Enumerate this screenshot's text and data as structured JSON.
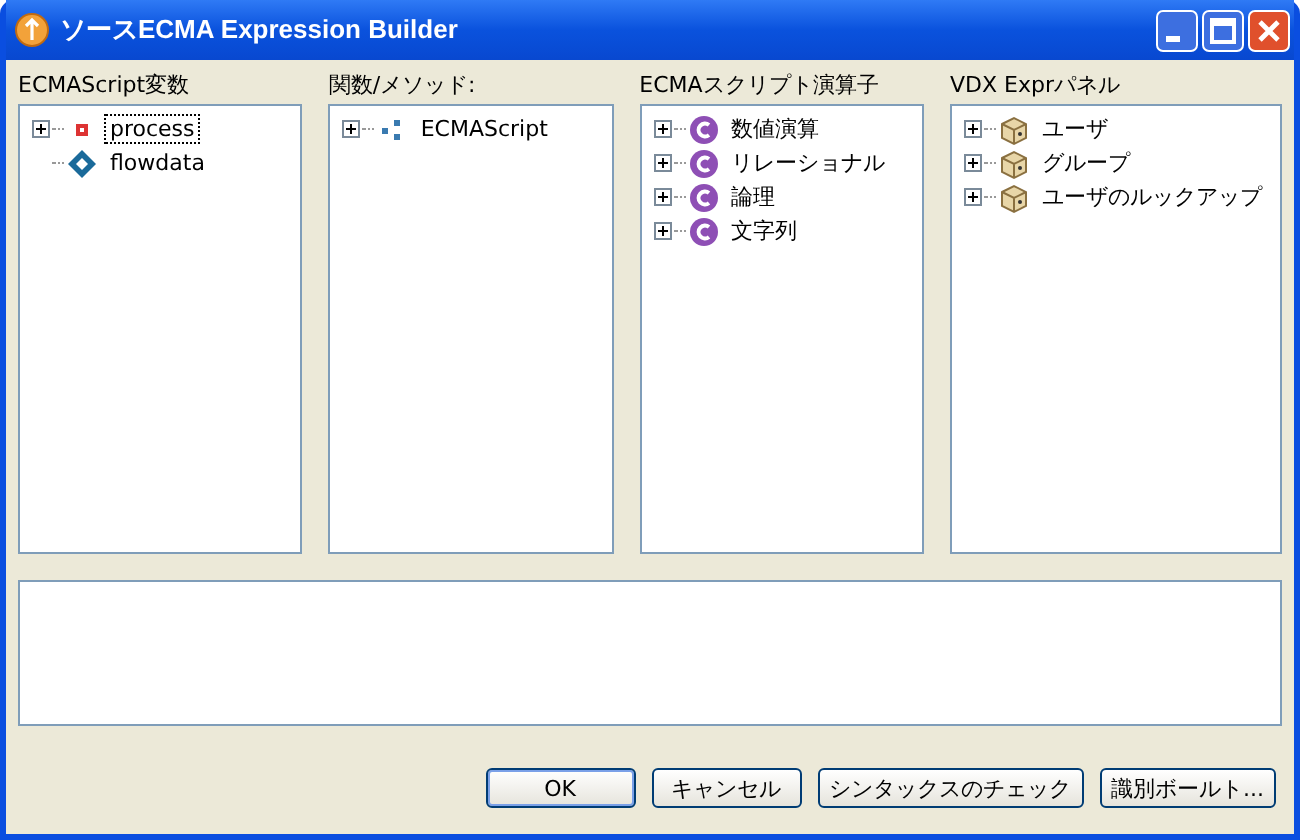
{
  "window": {
    "title": "ソースECMA Expression Builder"
  },
  "panels": [
    {
      "label": "ECMAScript変数",
      "items": [
        {
          "text": "process",
          "kind": "variable",
          "expandable": true,
          "selected": true
        },
        {
          "text": "flowdata",
          "kind": "data",
          "expandable": false,
          "selected": false
        }
      ]
    },
    {
      "label": "関数/メソッド:",
      "items": [
        {
          "text": "ECMAScript",
          "kind": "namespace",
          "expandable": true,
          "selected": false
        }
      ]
    },
    {
      "label": "ECMAスクリプト演算子",
      "items": [
        {
          "text": "数値演算",
          "kind": "class",
          "expandable": true,
          "selected": false
        },
        {
          "text": "リレーショナル",
          "kind": "class",
          "expandable": true,
          "selected": false
        },
        {
          "text": "論理",
          "kind": "class",
          "expandable": true,
          "selected": false
        },
        {
          "text": "文字列",
          "kind": "class",
          "expandable": true,
          "selected": false
        }
      ]
    },
    {
      "label": "VDX Exprパネル",
      "items": [
        {
          "text": "ユーザ",
          "kind": "package",
          "expandable": true,
          "selected": false
        },
        {
          "text": "グループ",
          "kind": "package",
          "expandable": true,
          "selected": false
        },
        {
          "text": "ユーザのルックアップ",
          "kind": "package",
          "expandable": true,
          "selected": false
        }
      ]
    }
  ],
  "buttons": [
    {
      "label": "OK",
      "default": true
    },
    {
      "label": "キャンセル",
      "default": false
    },
    {
      "label": "シンタックスのチェック",
      "default": false
    },
    {
      "label": "識別ボールト...",
      "default": false
    }
  ]
}
